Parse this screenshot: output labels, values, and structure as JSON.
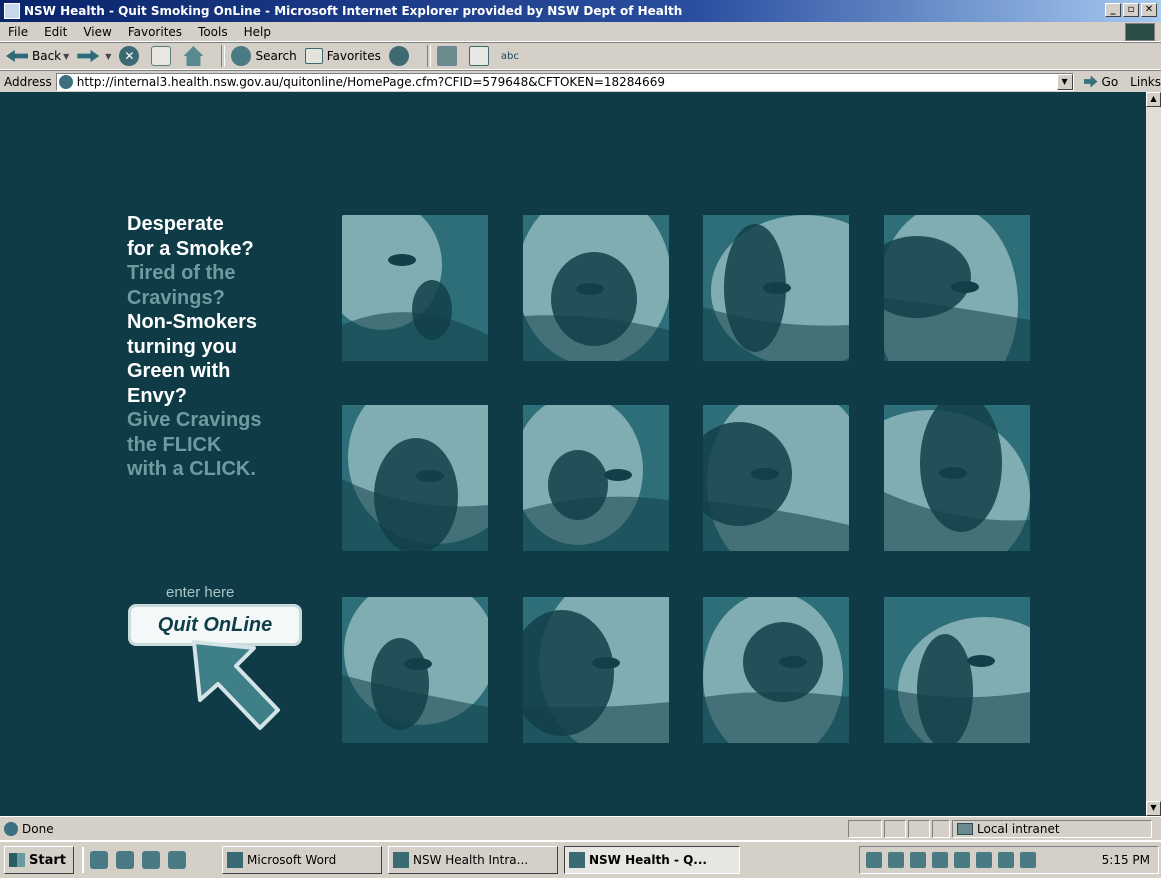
{
  "window": {
    "title": "NSW Health - Quit Smoking OnLine - Microsoft Internet Explorer provided by NSW Dept of Health",
    "buttons": [
      "_",
      "▫",
      "✕"
    ]
  },
  "menu": [
    "File",
    "Edit",
    "View",
    "Favorites",
    "Tools",
    "Help"
  ],
  "toolbar": {
    "back": "Back",
    "search": "Search",
    "favorites": "Favorites",
    "spell": "abc"
  },
  "address": {
    "label": "Address",
    "url": "http://internal3.health.nsw.gov.au/quitonline/HomePage.cfm?CFID=579648&CFTOKEN=18284669",
    "go": "Go",
    "links": "Links"
  },
  "page": {
    "headline": [
      {
        "text": "Desperate",
        "tone": "white"
      },
      {
        "text": "for a Smoke?",
        "tone": "white"
      },
      {
        "text": "Tired of the",
        "tone": "muted"
      },
      {
        "text": "Cravings?",
        "tone": "muted"
      },
      {
        "text": "Non-Smokers",
        "tone": "white"
      },
      {
        "text": "turning you",
        "tone": "white"
      },
      {
        "text": "Green with",
        "tone": "white"
      },
      {
        "text": "Envy?",
        "tone": "white"
      },
      {
        "text": "Give Cravings",
        "tone": "muted"
      },
      {
        "text": "the FLICK",
        "tone": "muted"
      },
      {
        "text": "with a CLICK.",
        "tone": "muted"
      }
    ],
    "enter_here": "enter here",
    "quit_button": "Quit OnLine"
  },
  "status": {
    "text": "Done",
    "zone": "Local intranet"
  },
  "taskbar": {
    "start": "Start",
    "tasks": [
      {
        "label": "Microsoft Word",
        "active": false
      },
      {
        "label": "NSW Health Intra...",
        "active": false
      },
      {
        "label": "NSW Health - Q...",
        "active": true
      }
    ],
    "clock": "5:15 PM"
  },
  "colors": {
    "page_bg": "#0e3b45",
    "headline_white": "#ffffff",
    "headline_muted": "#6f9aa0",
    "tile_dark": "#123f48",
    "tile_mid": "#2e6e78",
    "tile_light": "#9cc3c6"
  }
}
